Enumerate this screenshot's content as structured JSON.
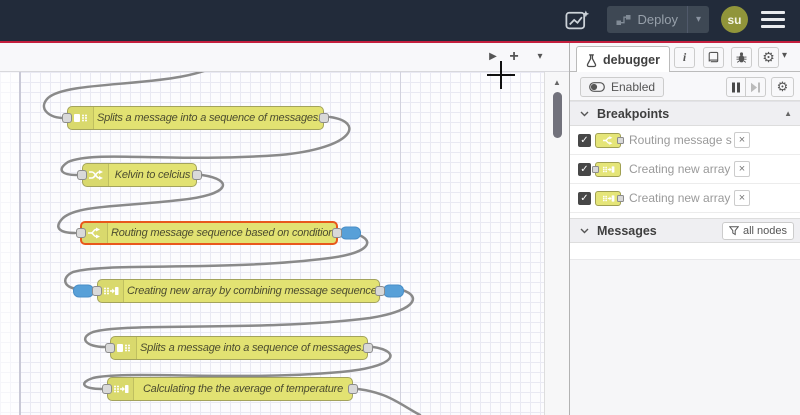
{
  "header": {
    "deploy_label": "Deploy",
    "avatar_initials": "su"
  },
  "canvas": {
    "nodes": [
      {
        "type": "split",
        "label": "Splits a message into a sequence of messages."
      },
      {
        "type": "change",
        "label": "Kelvin to celcius"
      },
      {
        "type": "switch",
        "label": "Routing message sequence based on condition",
        "selected": true,
        "breakpoint_ports": [
          "output"
        ]
      },
      {
        "type": "join",
        "label": "Creating new array by combining message sequence",
        "breakpoint_ports": [
          "input",
          "output"
        ]
      },
      {
        "type": "split",
        "label": "Splits a message into a sequence of messages."
      },
      {
        "type": "join",
        "label": "Calculating the the average of temperature"
      }
    ]
  },
  "sidebar": {
    "tab_label": "debugger",
    "toolbar": {
      "enabled_label": "Enabled"
    },
    "breakpoints": {
      "title": "Breakpoints",
      "items": [
        {
          "checked": true,
          "node_type": "switch",
          "port_side": "right",
          "label": "Routing message sequence based on condition"
        },
        {
          "checked": true,
          "node_type": "join",
          "port_side": "left",
          "label": "Creating new array by combining message sequence"
        },
        {
          "checked": true,
          "node_type": "join",
          "port_side": "right",
          "label": "Creating new array by combining message sequence"
        }
      ]
    },
    "messages": {
      "title": "Messages",
      "filter_label": "all nodes"
    }
  },
  "icons": {
    "plus": "+",
    "play": "▶",
    "caret_down": "▾",
    "scroll_up": "▲",
    "close": "×",
    "gear": "⚙",
    "info": "i",
    "check": "✓"
  },
  "colors": {
    "header_bg": "#222b3a",
    "accent_red": "#c41f3e",
    "node_yellow": "#e2e272",
    "selected_orange": "#e8581c",
    "breakpoint_blue": "#58a0d8",
    "wire_gray": "#8a8a8a"
  }
}
